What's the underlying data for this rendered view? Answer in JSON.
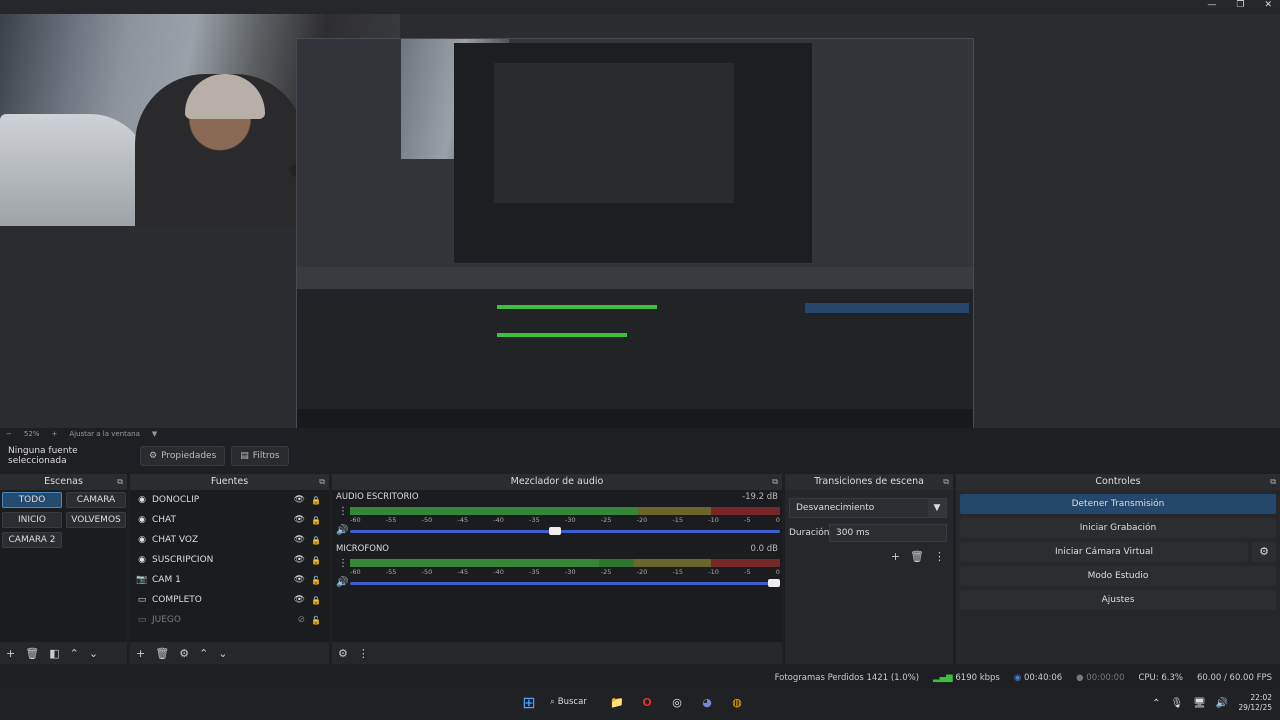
{
  "titlebar": {
    "minimize": "—",
    "maximize": "❐",
    "close": "✕"
  },
  "zoom": {
    "minus": "−",
    "level": "52%",
    "plus": "+",
    "fit": "Ajustar a la ventana",
    "dd": "▼"
  },
  "toolbar": {
    "source": "Ninguna fuente seleccionada",
    "props_icon": "⚙",
    "props": "Propiedades",
    "filters_icon": "▤",
    "filters": "Filtros"
  },
  "panels": {
    "popout": "⧉"
  },
  "scenes": {
    "title": "Escenas",
    "items": [
      {
        "label": "TODO",
        "active": true
      },
      {
        "label": "CAMARA"
      },
      {
        "label": "INICIO"
      },
      {
        "label": "VOLVEMOS"
      },
      {
        "label": "CAMARA 2"
      }
    ],
    "foot": [
      "+",
      "🗑",
      "◧",
      "⌃",
      "⌄"
    ]
  },
  "sources": {
    "title": "Fuentes",
    "items": [
      {
        "icon": "◉",
        "label": "DONOCLIP",
        "eye": "👁",
        "lock": "🔒"
      },
      {
        "icon": "◉",
        "label": "CHAT",
        "eye": "👁",
        "lock": "🔒"
      },
      {
        "icon": "◉",
        "label": "CHAT VOZ",
        "eye": "👁",
        "lock": "🔒"
      },
      {
        "icon": "◉",
        "label": "SUSCRIPCION",
        "eye": "👁",
        "lock": "🔒"
      },
      {
        "icon": "📷",
        "label": "CAM 1",
        "eye": "👁",
        "lock": "🔓"
      },
      {
        "icon": "▭",
        "label": "COMPLETO",
        "eye": "👁",
        "lock": "🔒"
      },
      {
        "icon": "▭",
        "label": "JUEGO",
        "eye": "⊘",
        "lock": "🔓",
        "dim": true
      }
    ],
    "foot": [
      "+",
      "🗑",
      "⚙",
      "⌃",
      "⌄"
    ]
  },
  "mixer": {
    "title": "Mezclador de audio",
    "ticks": [
      "-60",
      "-55",
      "-50",
      "-45",
      "-40",
      "-35",
      "-30",
      "-25",
      "-20",
      "-15",
      "-10",
      "-5",
      "0"
    ],
    "channels": [
      {
        "name": "AUDIO ESCRITORIO",
        "db": "-19.2 dB",
        "level": 0.67,
        "volume": 0.49
      },
      {
        "name": "MICROFONO",
        "db": "0.0 dB",
        "level": 0.58,
        "volume": 1.0
      }
    ],
    "menu": "⋮",
    "speaker": "🔊",
    "foot": [
      "⚙",
      "⋮"
    ]
  },
  "transitions": {
    "title": "Transiciones de escena",
    "selected": "Desvanecimiento",
    "dd": "▼",
    "duration_label": "Duración",
    "duration_value": "300 ms",
    "btns": [
      "+",
      "🗑",
      "⋮"
    ]
  },
  "controls": {
    "title": "Controles",
    "stop_stream": "Detener Transmisión",
    "start_rec": "Iniciar Grabación",
    "start_vcam": "Iniciar Cámara Virtual",
    "gear": "⚙",
    "studio": "Modo Estudio",
    "settings": "Ajustes"
  },
  "status": {
    "dropped": "Fotogramas Perdidos 1421 (1.0%)",
    "bars": "▂▄▆",
    "bitrate": "6190 kbps",
    "stream_icon": "◉",
    "stream_time": "00:40:06",
    "rec_icon": "●",
    "rec_time": "00:00:00",
    "cpu": "CPU: 6.3%",
    "fps": "60.00 / 60.00 FPS"
  },
  "taskbar": {
    "start": "⊞",
    "search": "Buscar",
    "search_icon": "⌕",
    "files": "📁",
    "opera": "O",
    "obs": "◎",
    "discord": "◕",
    "chrome": "◍",
    "tray_up": "⌃",
    "mic": "🎙",
    "net": "🖥",
    "vol": "🔊",
    "time": "22:02",
    "date": "29/12/25"
  }
}
